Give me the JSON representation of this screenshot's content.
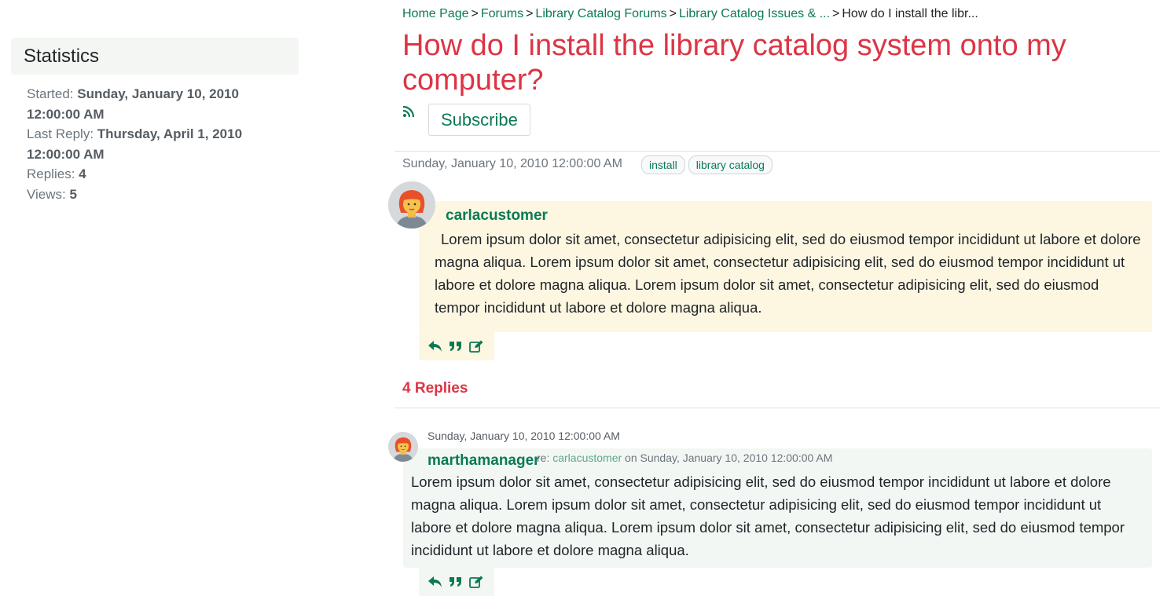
{
  "sidebar": {
    "heading": "Statistics",
    "started_label": "Started:",
    "started_value": "Sunday, January 10, 2010 12:00:00 AM",
    "last_reply_label": "Last Reply:",
    "last_reply_value": "Thursday, April 1, 2010 12:00:00 AM",
    "replies_label": "Replies:",
    "replies_value": "4",
    "views_label": "Views:",
    "views_value": "5"
  },
  "breadcrumb": {
    "items": [
      "Home Page",
      "Forums",
      "Library Catalog Forums",
      "Library Catalog Issues & ..."
    ],
    "current": "How do I install the libr...",
    "separator": ">"
  },
  "thread": {
    "title": "How do I install the library catalog system onto my computer?",
    "subscribe_label": "Subscribe",
    "rss_icon": "rss-icon"
  },
  "post": {
    "date": "Sunday, January 10, 2010 12:00:00 AM",
    "tags": [
      "install",
      "library catalog"
    ],
    "author": "carlacustomer",
    "body": "Lorem ipsum dolor sit amet, consectetur adipisicing elit, sed do eiusmod tempor incididunt ut labore et dolore magna aliqua. Lorem ipsum dolor sit amet, consectetur adipisicing elit, sed do eiusmod tempor incididunt ut labore et dolore magna aliqua. Lorem ipsum dolor sit amet, consectetur adipisicing elit, sed do eiusmod tempor incididunt ut labore et dolore magna aliqua.",
    "actions": [
      "reply-icon",
      "quote-icon",
      "edit-icon"
    ]
  },
  "replies": {
    "heading": "4 Replies",
    "items": [
      {
        "date": "Sunday, January 10, 2010 12:00:00 AM",
        "author": "marthamanager",
        "re_prefix": "re:",
        "re_user": "carlacustomer",
        "re_suffix": "on Sunday, January 10, 2010 12:00:00 AM",
        "body": "Lorem ipsum dolor sit amet, consectetur adipisicing elit, sed do eiusmod tempor incididunt ut labore et dolore magna aliqua. Lorem ipsum dolor sit amet, consectetur adipisicing elit, sed do eiusmod tempor incididunt ut labore et dolore magna aliqua. Lorem ipsum dolor sit amet, consectetur adipisicing elit, sed do eiusmod tempor incididunt ut labore et dolore magna aliqua."
      }
    ]
  },
  "colors": {
    "accent": "#0a7a55",
    "title": "#dc3545",
    "post_bg": "#fdf7e2",
    "reply_bg": "#f3f7f4"
  }
}
